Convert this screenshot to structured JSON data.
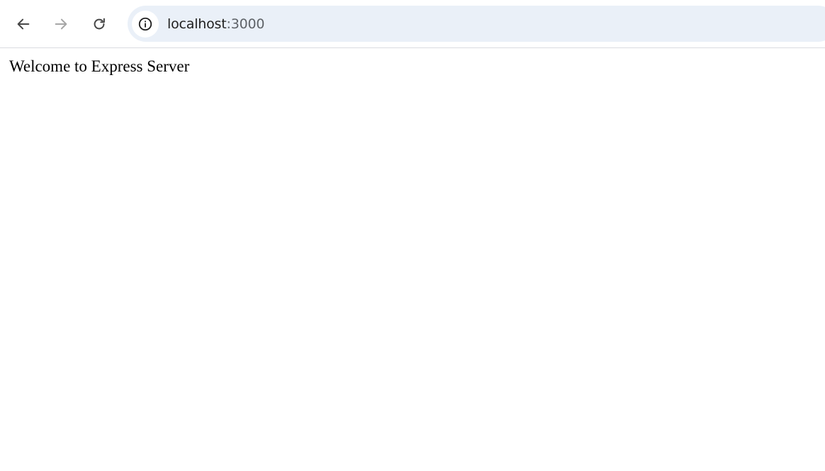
{
  "browser": {
    "icons": {
      "back": "arrow-left-icon",
      "forward": "arrow-right-icon",
      "reload": "reload-icon",
      "site_info": "info-icon"
    },
    "colors": {
      "icon_active": "#474747",
      "icon_disabled": "#a6a6a6",
      "omnibox_bg": "#eaf0f8"
    },
    "address_bar": {
      "host": "localhost",
      "port": ":3000"
    }
  },
  "page": {
    "body_text": "Welcome to Express Server"
  }
}
